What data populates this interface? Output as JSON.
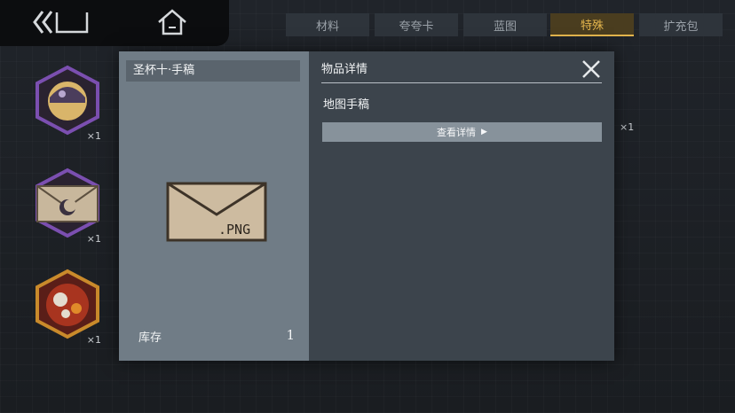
{
  "tabs": [
    {
      "label": "材料",
      "active": false
    },
    {
      "label": "夸夸卡",
      "active": false
    },
    {
      "label": "蓝图",
      "active": false
    },
    {
      "label": "特殊",
      "active": true
    },
    {
      "label": "扩充包",
      "active": false
    }
  ],
  "side_items": [
    {
      "icon": "helmet-orb-icon",
      "count": "×1",
      "frame_color": "#7b4fb0"
    },
    {
      "icon": "moon-envelope-icon",
      "count": "×1",
      "frame_color": "#7b4fb0"
    },
    {
      "icon": "red-food-icon",
      "count": "×1",
      "frame_color": "#c98a2b"
    }
  ],
  "right_count": "×1",
  "modal": {
    "item_title": "圣杯十·手稿",
    "envelope_text": ".PNG",
    "stock_label": "库存",
    "stock_value": "1",
    "detail_header": "物品详情",
    "item_name": "地图手稿",
    "view_detail_label": "查看详情",
    "view_detail_arrow": "▶"
  },
  "colors": {
    "accent_gold": "#e2b44c",
    "modal_bg": "#3c444c",
    "left_panel_bg": "#707c86"
  }
}
